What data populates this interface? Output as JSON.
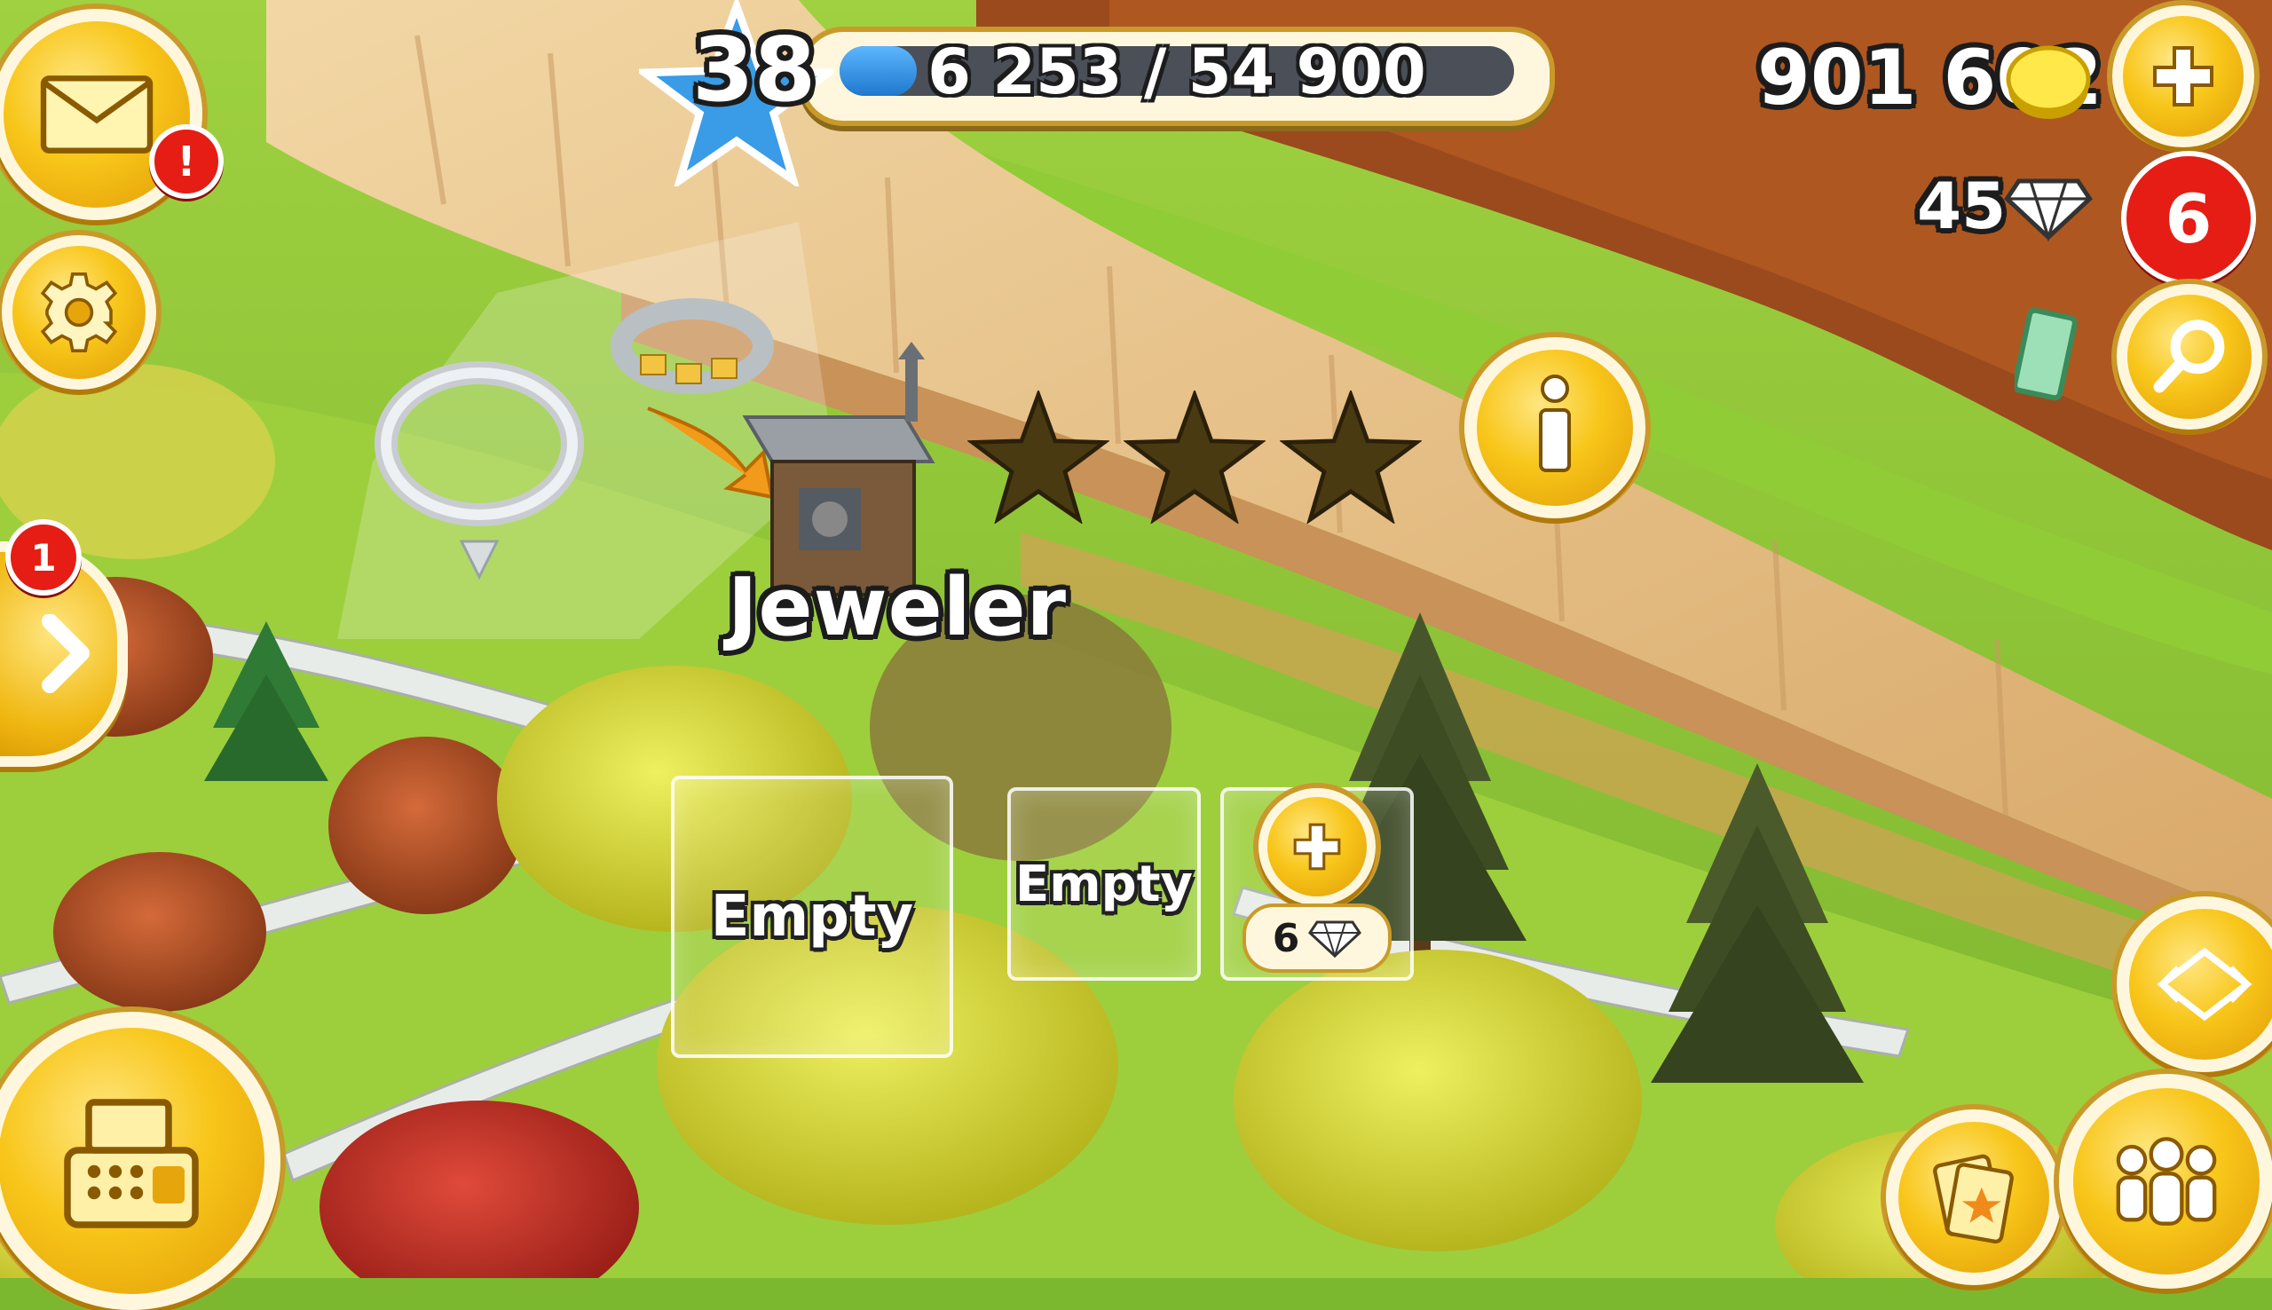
{
  "hud": {
    "level": "38",
    "xp_text": "6 253 / 54 900",
    "xp_progress": 0.114,
    "coins": "901 602",
    "diamonds": "45",
    "diamond_badge": "6",
    "mail_badge": "!",
    "side_badge": "1"
  },
  "building": {
    "name": "Jeweler",
    "stars_total": 3,
    "stars_earned": 0
  },
  "production_slots": [
    {
      "label": "Empty"
    },
    {
      "label": "Empty"
    }
  ],
  "unlock_slot": {
    "cost": "6"
  },
  "colors": {
    "hud_yellow": "#f8c61a",
    "xp_bar_fill": "#2f8fe0",
    "badge_red": "#e51d14",
    "grass": "#8cc83a",
    "cliff": "#e9c48a"
  },
  "icons": {
    "mail": "envelope-icon",
    "settings": "gear-icon",
    "side_panel": "chevron-right-icon",
    "shop": "cash-register-icon",
    "add_coins": "plus-icon",
    "search": "magnifier-icon",
    "info": "info-icon",
    "friends": "people-icon",
    "news": "cards-icon",
    "edit": "move-arrows-icon"
  }
}
